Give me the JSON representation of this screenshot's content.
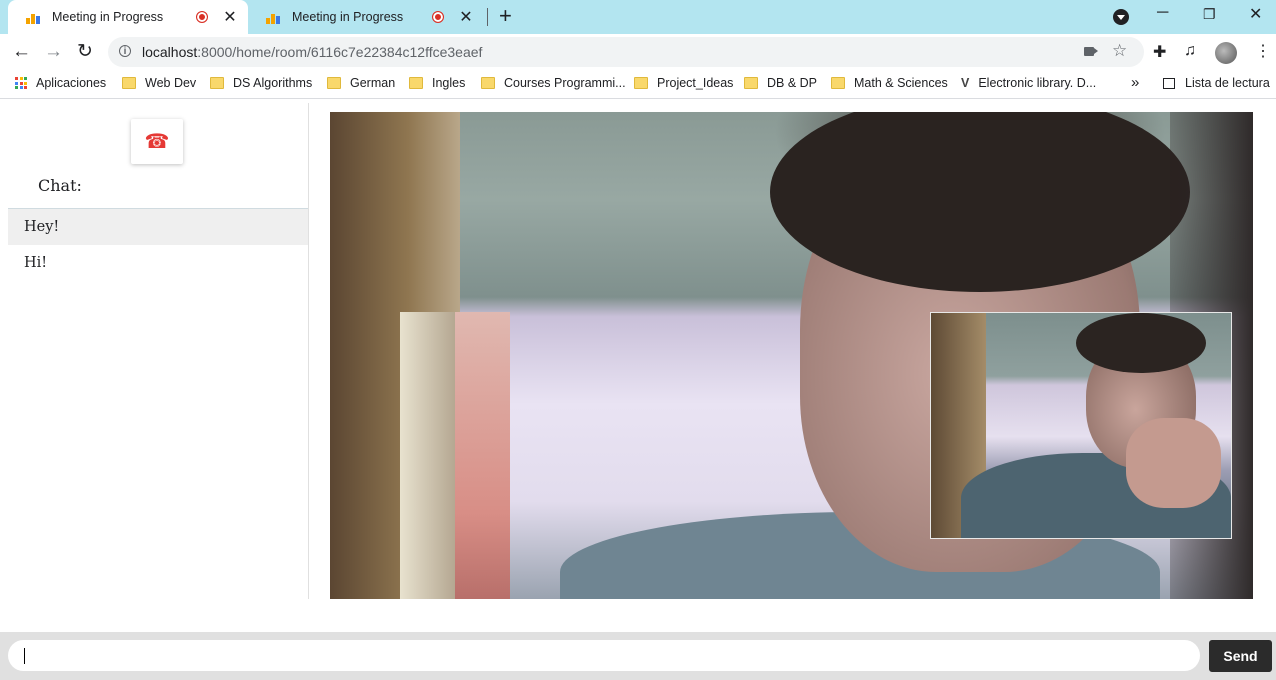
{
  "browser": {
    "tabs": [
      {
        "title": "Meeting in Progress",
        "active": true,
        "recording": true
      },
      {
        "title": "Meeting in Progress",
        "active": false,
        "recording": true
      }
    ],
    "tab_close_icon": "close-icon",
    "new_tab_icon": "plus-icon",
    "window_controls": {
      "minimize": "─",
      "restore": "❐",
      "close": "✕"
    },
    "url_host": "localhost",
    "url_rest": ":8000/home/room/6116c7e22384c12ffce3eaef",
    "bookmarks": [
      {
        "label": "Aplicaciones",
        "icon": "apps-icon"
      },
      {
        "label": "Web Dev",
        "icon": "folder-icon"
      },
      {
        "label": "DS Algorithms",
        "icon": "folder-icon"
      },
      {
        "label": "German",
        "icon": "folder-icon"
      },
      {
        "label": "Ingles",
        "icon": "folder-icon"
      },
      {
        "label": "Courses Programmi...",
        "icon": "folder-icon"
      },
      {
        "label": "Project_Ideas",
        "icon": "folder-icon"
      },
      {
        "label": "DB & DP",
        "icon": "folder-icon"
      },
      {
        "label": "Math & Sciences",
        "icon": "folder-icon"
      },
      {
        "label": "Electronic library. D...",
        "icon": "v-logo-icon"
      }
    ],
    "bookmarks_overflow": "»",
    "reading_list": "Lista de lectura"
  },
  "app": {
    "hangup_icon": "phone-hangup-icon",
    "chat_title": "Chat:",
    "messages": [
      {
        "text": "Hey!"
      },
      {
        "text": "Hi!"
      }
    ],
    "input_value": "",
    "send_label": "Send",
    "colors": {
      "hangup": "#e53935",
      "send_bg": "#2b2b2b",
      "tabstrip": "#b3e5f0"
    }
  }
}
